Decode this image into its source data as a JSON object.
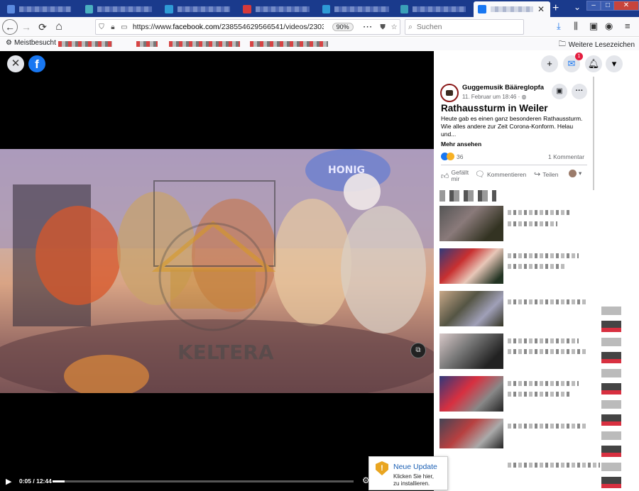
{
  "browser": {
    "url_secure": "https://www.",
    "url_domain": "facebook.com",
    "url_path": "/238554629566541/videos/23034",
    "zoom": "90%",
    "search_placeholder": "Suchen",
    "bookmarks": {
      "meistbesucht": "Meistbesucht",
      "weitere": "Weitere Lesezeichen"
    },
    "new_tab": "+",
    "back": "←",
    "forward": "→",
    "reload": "⟳",
    "home": "⌂"
  },
  "video": {
    "close_icon": "✕",
    "fb_icon": "f",
    "time": "0:05 / 12:44",
    "progress": 0.0065,
    "watermark": "KELTERA",
    "stage_sign": "HONIG"
  },
  "panel": {
    "page_name": "Guggemusik Bääreglopfa",
    "post_date": "11. Februar um 18:46 ·",
    "post_title": "Rathaussturm in Weiler",
    "post_body": "Heute gab es einen ganz besonderen Rathaussturm. Wie alles andere zur Zeit Corona-Konform. Helau und...",
    "more_link": "Mehr ansehen",
    "reactions_count": "36",
    "comments_count": "1 Kommentar",
    "like_label": "Gefällt mir",
    "comment_label": "Kommentieren",
    "share_label": "Teilen",
    "messenger_badge": "1"
  },
  "update": {
    "title": "Neue Update",
    "sub1": "Klicken Sie hier,",
    "sub2": "zu installieren."
  },
  "colors": {
    "facebook_blue": "#1877f2",
    "tabstrip": "#1a3a8c",
    "notification_red": "#e41e3f",
    "update_shield": "#e9a520"
  }
}
